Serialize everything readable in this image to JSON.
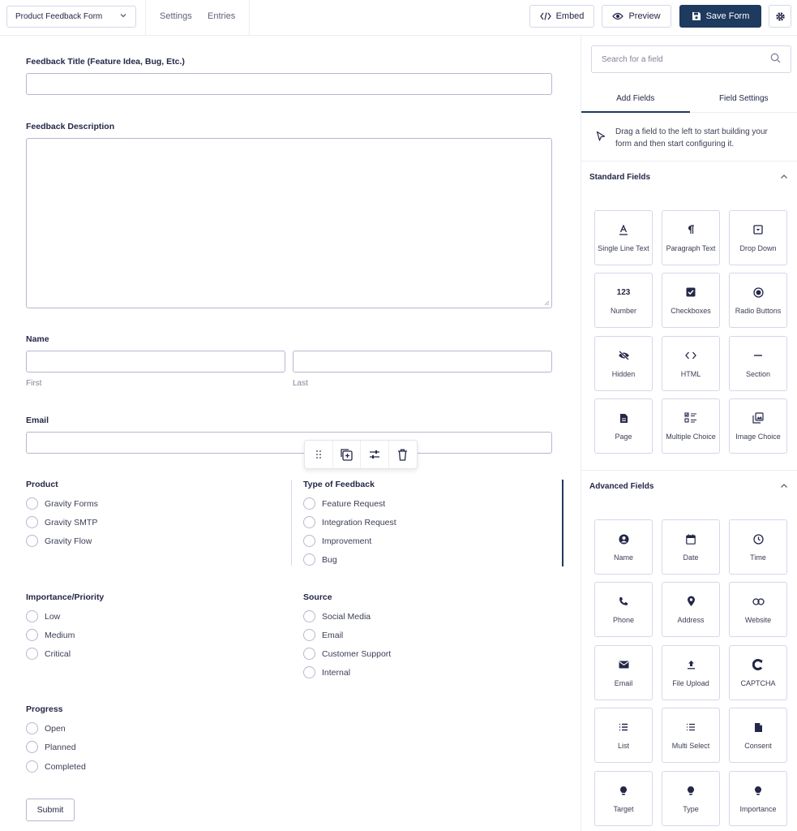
{
  "header": {
    "form_name": "Product Feedback Form",
    "nav": [
      "Settings",
      "Entries"
    ],
    "embed_label": "Embed",
    "preview_label": "Preview",
    "save_label": "Save Form"
  },
  "form": {
    "title_label": "Feedback Title (Feature Idea, Bug, Etc.)",
    "description_label": "Feedback Description",
    "name_label": "Name",
    "name_first": "First",
    "name_last": "Last",
    "email_label": "Email",
    "product": {
      "label": "Product",
      "options": [
        "Gravity Forms",
        "Gravity SMTP",
        "Gravity Flow"
      ]
    },
    "type": {
      "label": "Type of Feedback",
      "options": [
        "Feature Request",
        "Integration Request",
        "Improvement",
        "Bug"
      ]
    },
    "importance": {
      "label": "Importance/Priority",
      "options": [
        "Low",
        "Medium",
        "Critical"
      ]
    },
    "source": {
      "label": "Source",
      "options": [
        "Social Media",
        "Email",
        "Customer Support",
        "Internal"
      ]
    },
    "progress": {
      "label": "Progress",
      "options": [
        "Open",
        "Planned",
        "Completed"
      ]
    },
    "submit_label": "Submit"
  },
  "panel": {
    "search_placeholder": "Search for a field",
    "tabs": [
      "Add Fields",
      "Field Settings"
    ],
    "hint": "Drag a field to the left to start building your form and then start configuring it.",
    "standard_title": "Standard Fields",
    "standard_fields": [
      "Single Line Text",
      "Paragraph Text",
      "Drop Down",
      "Number",
      "Checkboxes",
      "Radio Buttons",
      "Hidden",
      "HTML",
      "Section",
      "Page",
      "Multiple Choice",
      "Image Choice"
    ],
    "advanced_title": "Advanced Fields",
    "advanced_fields": [
      "Name",
      "Date",
      "Time",
      "Phone",
      "Address",
      "Website",
      "Email",
      "File Upload",
      "CAPTCHA",
      "List",
      "Multi Select",
      "Consent",
      "Target",
      "Type",
      "Importance"
    ],
    "number_icon_text": "123"
  },
  "colors": {
    "accent": "#1e3a5f",
    "border": "#d5d7e9",
    "text": "#242748"
  }
}
